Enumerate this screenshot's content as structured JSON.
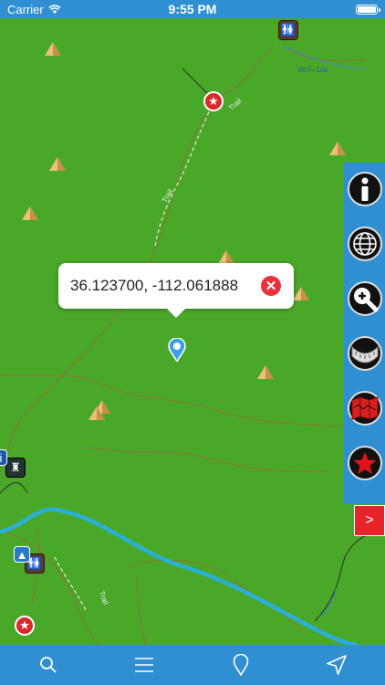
{
  "status": {
    "carrier": "Carrier",
    "time": "9:55 PM"
  },
  "popup": {
    "coordinates": "36.123700, -112.061888"
  },
  "map": {
    "labels": {
      "creek": "Wi Fi Crk",
      "trail_1": "Trail",
      "trail_2": "Trail",
      "trail_3": "Trail"
    }
  },
  "tools": [
    {
      "name": "info",
      "icon": "info-icon"
    },
    {
      "name": "globe",
      "icon": "globe-icon"
    },
    {
      "name": "zoom",
      "icon": "zoom-in-icon"
    },
    {
      "name": "measure",
      "icon": "ruler-icon"
    },
    {
      "name": "map-layers",
      "icon": "folded-map-icon"
    },
    {
      "name": "favorites",
      "icon": "star-icon"
    }
  ],
  "expand_label": ">",
  "tabbar": [
    {
      "name": "search",
      "icon": "search-icon"
    },
    {
      "name": "menu",
      "icon": "menu-icon"
    },
    {
      "name": "pin",
      "icon": "location-pin-icon"
    },
    {
      "name": "navigate",
      "icon": "navigation-arrow-icon"
    }
  ],
  "colors": {
    "map_green": "#4aa828",
    "panel_blue": "#2f8fd0",
    "river": "#2ab0d8",
    "accent_red": "#e8232a"
  }
}
